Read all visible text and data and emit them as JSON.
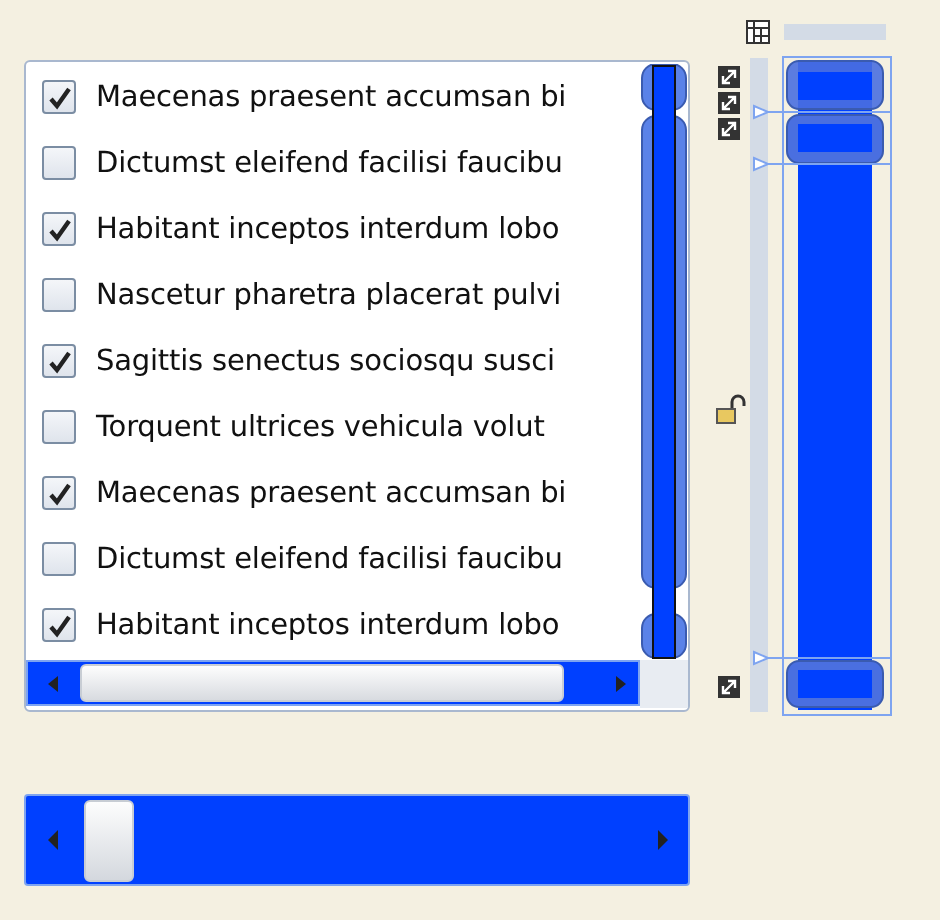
{
  "list": {
    "items": [
      {
        "label": "Maecenas praesent accumsan bi",
        "checked": true
      },
      {
        "label": "Dictumst eleifend facilisi faucibu",
        "checked": false
      },
      {
        "label": "Habitant inceptos interdum lobo",
        "checked": true
      },
      {
        "label": "Nascetur pharetra placerat pulvi",
        "checked": false
      },
      {
        "label": "Sagittis senectus sociosqu susci",
        "checked": true
      },
      {
        "label": "Torquent ultrices vehicula volut",
        "checked": false
      },
      {
        "label": "Maecenas praesent accumsan bi",
        "checked": true
      },
      {
        "label": "Dictumst eleifend facilisi faucibu",
        "checked": false
      },
      {
        "label": "Habitant inceptos interdum lobo",
        "checked": true
      }
    ]
  }
}
